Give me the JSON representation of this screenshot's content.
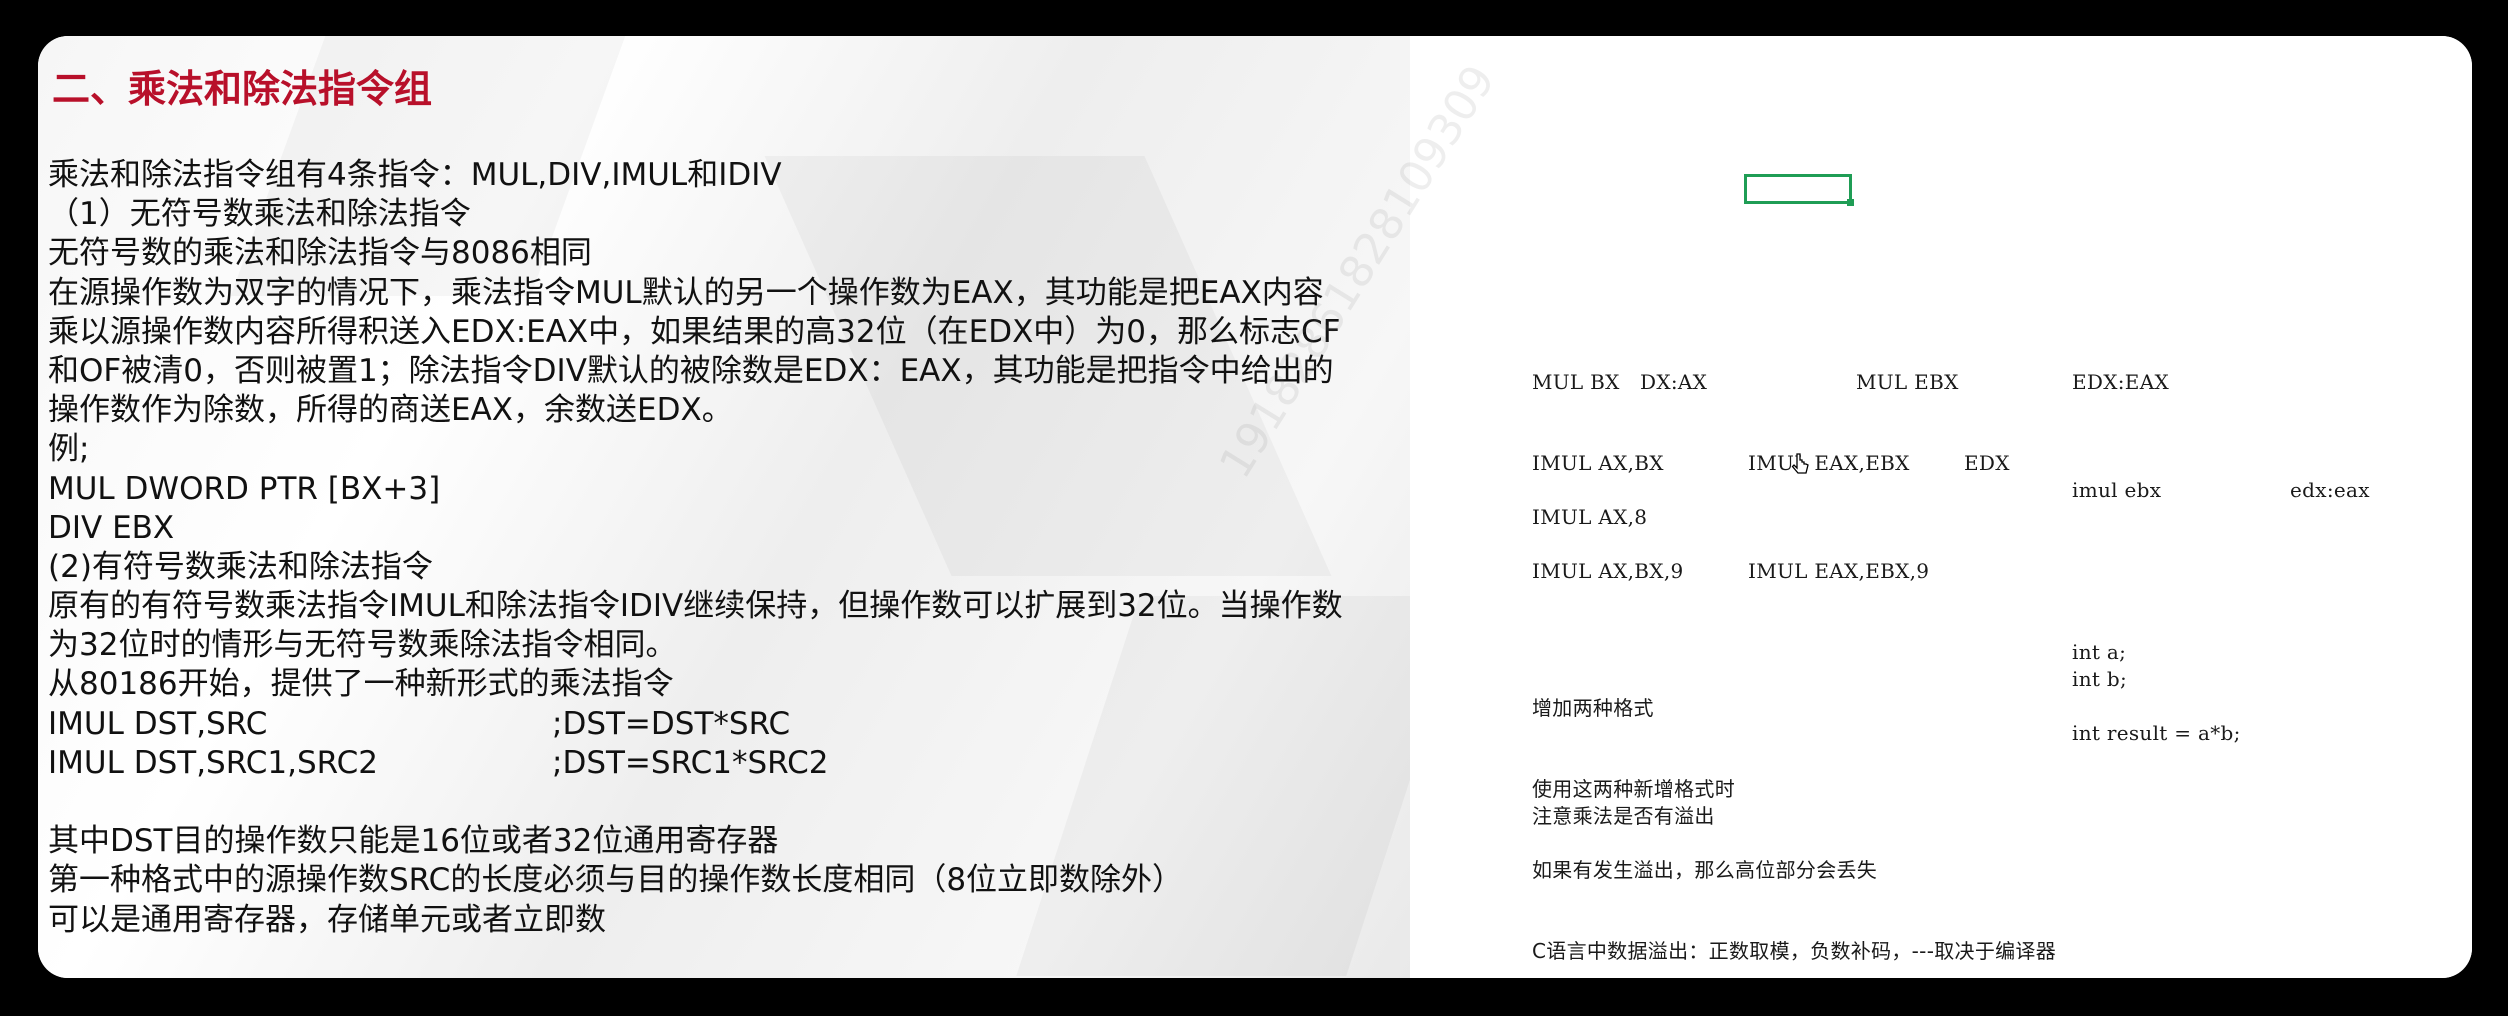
{
  "slide": {
    "title": "二、乘法和除法指令组",
    "lines": [
      "乘法和除法指令组有4条指令：MUL,DIV,IMUL和IDIV",
      "（1）无符号数乘法和除法指令",
      "无符号数的乘法和除法指令与8086相同",
      "在源操作数为双字的情况下，乘法指令MUL默认的另一个操作数为EAX，其功能是把EAX内容",
      "乘以源操作数内容所得积送入EDX:EAX中，如果结果的高32位（在EDX中）为0，那么标志CF",
      "和OF被清0，否则被置1；除法指令DIV默认的被除数是EDX：EAX，其功能是把指令中给出的",
      "操作数作为除数，所得的商送EAX，余数送EDX。",
      "例;",
      "MUL DWORD PTR [BX+3]",
      "DIV EBX",
      "(2)有符号数乘法和除法指令",
      "原有的有符号数乘法指令IMUL和除法指令IDIV继续保持，但操作数可以扩展到32位。当操作数",
      "为32位时的情形与无符号数乘除法指令相同。",
      "从80186开始，提供了一种新形式的乘法指令"
    ],
    "code_rows": [
      {
        "instr": "IMUL DST,SRC",
        "comment": ";DST=DST*SRC"
      },
      {
        "instr": "IMUL DST,SRC1,SRC2",
        "comment": ";DST=SRC1*SRC2"
      }
    ],
    "tail_lines": [
      "其中DST目的操作数只能是16位或者32位通用寄存器",
      "第一种格式中的源操作数SRC的长度必须与目的操作数长度相同（8位立即数除外）",
      "可以是通用寄存器，存储单元或者立即数"
    ],
    "watermark": "19182861828109309"
  },
  "notes": {
    "row1": {
      "a": "MUL BX",
      "b": "DX:AX",
      "c": "MUL EBX",
      "d": "EDX:EAX"
    },
    "row2": {
      "a": "IMUL AX,BX",
      "b": "IMUL EAX,EBX",
      "c": "EDX"
    },
    "c_mul": {
      "a": "imul ebx",
      "b": "edx:eax"
    },
    "row3": "IMUL AX,8",
    "row4": {
      "a": "IMUL AX,BX,9",
      "b": "IMUL EAX,EBX,9"
    },
    "c_code": [
      "int a;",
      "int b;",
      "int result = a*b;"
    ],
    "add_formats": "增加两种格式",
    "use_note_1": "使用这两种新增格式时",
    "use_note_2": "注意乘法是否有溢出",
    "overflow_note": "如果有发生溢出，那么高位部分会丢失",
    "c_overflow": "C语言中数据溢出：正数取模，负数补码，---取决于编译器"
  },
  "colors": {
    "title_red": "#b8102a",
    "cell_border_green": "#1f9d55",
    "background": "#000000"
  },
  "icons": [
    "cursor-icon"
  ]
}
